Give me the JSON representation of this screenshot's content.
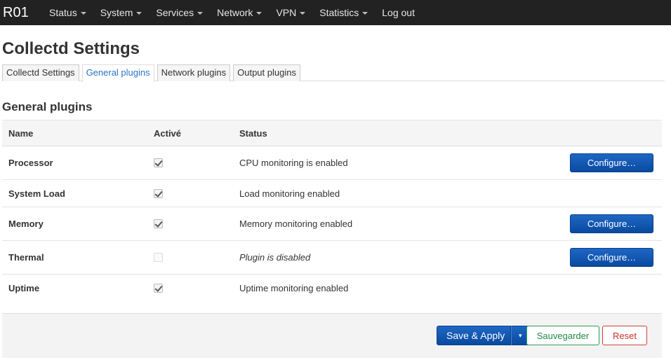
{
  "header": {
    "brand": "R01",
    "menu": [
      {
        "label": "Status",
        "dropdown": true
      },
      {
        "label": "System",
        "dropdown": true
      },
      {
        "label": "Services",
        "dropdown": true
      },
      {
        "label": "Network",
        "dropdown": true
      },
      {
        "label": "VPN",
        "dropdown": true
      },
      {
        "label": "Statistics",
        "dropdown": true
      },
      {
        "label": "Log out",
        "dropdown": false
      }
    ]
  },
  "page": {
    "title": "Collectd Settings",
    "tabs": [
      {
        "label": "Collectd Settings",
        "active": false
      },
      {
        "label": "General plugins",
        "active": true
      },
      {
        "label": "Network plugins",
        "active": false
      },
      {
        "label": "Output plugins",
        "active": false
      }
    ],
    "section_title": "General plugins"
  },
  "table": {
    "headers": {
      "name": "Name",
      "enabled": "Activé",
      "status": "Status"
    },
    "rows": [
      {
        "name": "Processor",
        "enabled": true,
        "status": "CPU monitoring is enabled",
        "configure": "Configure…"
      },
      {
        "name": "System Load",
        "enabled": true,
        "status": "Load monitoring enabled",
        "configure": null
      },
      {
        "name": "Memory",
        "enabled": true,
        "status": "Memory monitoring enabled",
        "configure": "Configure…"
      },
      {
        "name": "Thermal",
        "enabled": false,
        "status": "Plugin is disabled",
        "configure": "Configure…"
      },
      {
        "name": "Uptime",
        "enabled": true,
        "status": "Uptime monitoring enabled",
        "configure": null
      }
    ]
  },
  "footer": {
    "save_apply": "Save & Apply",
    "dropdown_arrow": "▾",
    "save": "Sauvegarder",
    "reset": "Reset"
  },
  "colors": {
    "topbar": "#222222",
    "primary": "#0a4aa0",
    "positive": "#1f8a4a",
    "negative": "#c9302c",
    "active_tab": "#2a74c0"
  }
}
